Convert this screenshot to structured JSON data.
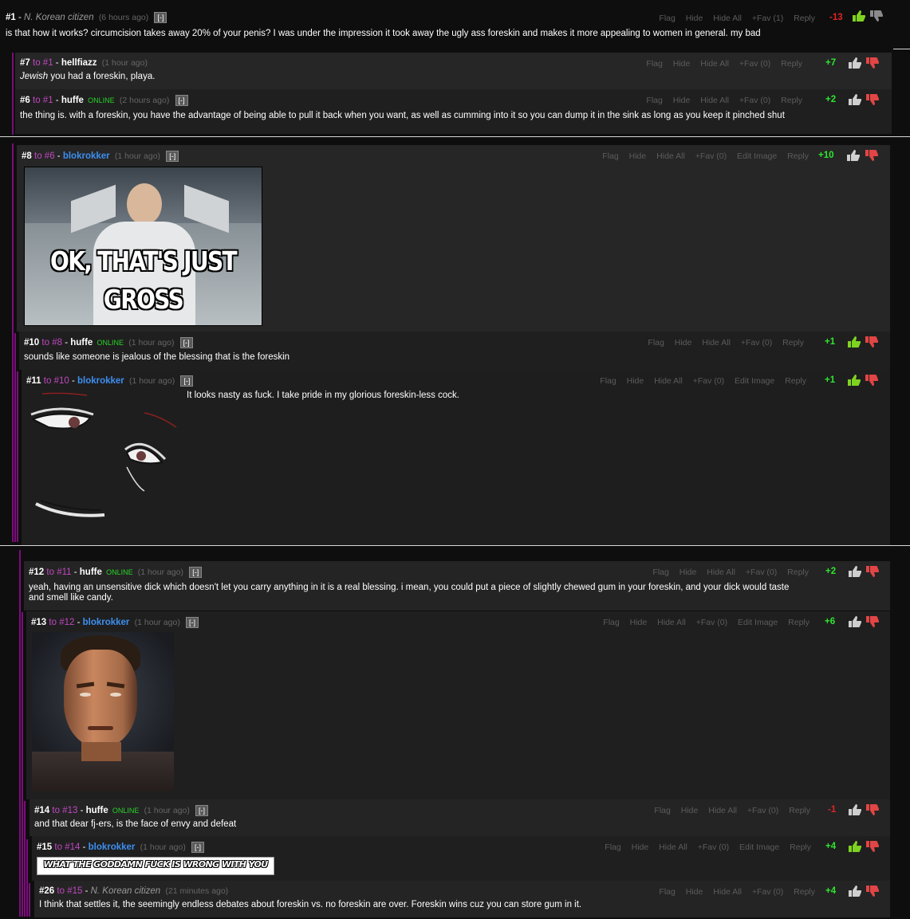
{
  "ui": {
    "collapse": "[-]",
    "to": "to",
    "online": "ONLINE",
    "actions": {
      "flag": "Flag",
      "hide": "Hide",
      "hide_all": "Hide All",
      "edit_image": "Edit Image",
      "reply": "Reply"
    }
  },
  "comments": [
    {
      "num": "#1",
      "user": "N. Korean citizen",
      "time": "(6 hours ago)",
      "fav": "+Fav (1)",
      "score": "-13",
      "body": "is that how it works? circumcision takes away 20% of your penis? I was under the impression it took away the ugly ass foreskin and makes it more appealing to women in general. my bad"
    },
    {
      "num": "#7",
      "reply_to": "#1",
      "user": "hellfiazz",
      "time": "(1 hour ago)",
      "fav": "+Fav (0)",
      "score": "+7",
      "body_em": "Jewish",
      "body": " you had a foreskin, playa."
    },
    {
      "num": "#6",
      "reply_to": "#1",
      "user": "huffe",
      "time": "(2 hours ago)",
      "fav": "+Fav (0)",
      "score": "+2",
      "body": "the thing is. with a foreskin, you have the advantage of being able to pull it back when you want, as well as cumming into it so you can dump it in the sink as long as you keep it pinched shut"
    },
    {
      "num": "#8",
      "reply_to": "#6",
      "user": "blokrokker",
      "time": "(1 hour ago)",
      "fav": "+Fav (0)",
      "score": "+10",
      "image_caption_1": "OK, THAT'S JUST",
      "image_caption_2": "GROSS"
    },
    {
      "num": "#10",
      "reply_to": "#8",
      "user": "huffe",
      "time": "(1 hour ago)",
      "fav": "+Fav (0)",
      "score": "+1",
      "body": "sounds like someone is jealous of the blessing that is the foreskin"
    },
    {
      "num": "#11",
      "reply_to": "#10",
      "user": "blokrokker",
      "time": "(1 hour ago)",
      "fav": "+Fav (0)",
      "score": "+1",
      "body": "It looks nasty as fuck. I take pride in my glorious foreskin-less cock."
    },
    {
      "num": "#12",
      "reply_to": "#11",
      "user": "huffe",
      "time": "(1 hour ago)",
      "fav": "+Fav (0)",
      "score": "+2",
      "body": "yeah, having an unsensitive dick which doesn't let you carry anything in it is a real blessing. i mean, you could put a piece of slightly chewed gum in your foreskin, and your dick would taste and smell like candy."
    },
    {
      "num": "#13",
      "reply_to": "#12",
      "user": "blokrokker",
      "time": "(1 hour ago)",
      "fav": "+Fav (0)",
      "score": "+6"
    },
    {
      "num": "#14",
      "reply_to": "#13",
      "user": "huffe",
      "time": "(1 hour ago)",
      "fav": "+Fav (0)",
      "score": "-1",
      "body": "and that dear fj-ers, is the face of envy and defeat"
    },
    {
      "num": "#15",
      "reply_to": "#14",
      "user": "blokrokker",
      "time": "(1 hour ago)",
      "fav": "+Fav (0)",
      "score": "+4",
      "image_text": "WHAT THE GODDAMN FUCK IS WRONG WITH YOU"
    },
    {
      "num": "#26",
      "reply_to": "#15",
      "user": "N. Korean citizen",
      "time": "(21 minutes ago)",
      "fav": "+Fav (0)",
      "score": "+4",
      "body": "I think that settles it, the seemingly endless debates about foreskin vs. no foreskin are over. Foreskin wins cuz you can store gum in it."
    }
  ],
  "colors": {
    "score_positive": "#2ee62e",
    "score_negative": "#e02525",
    "username_blue": "#3d8ff0",
    "reply_to": "#c148c1",
    "thread_line": "#7c0d7c"
  }
}
